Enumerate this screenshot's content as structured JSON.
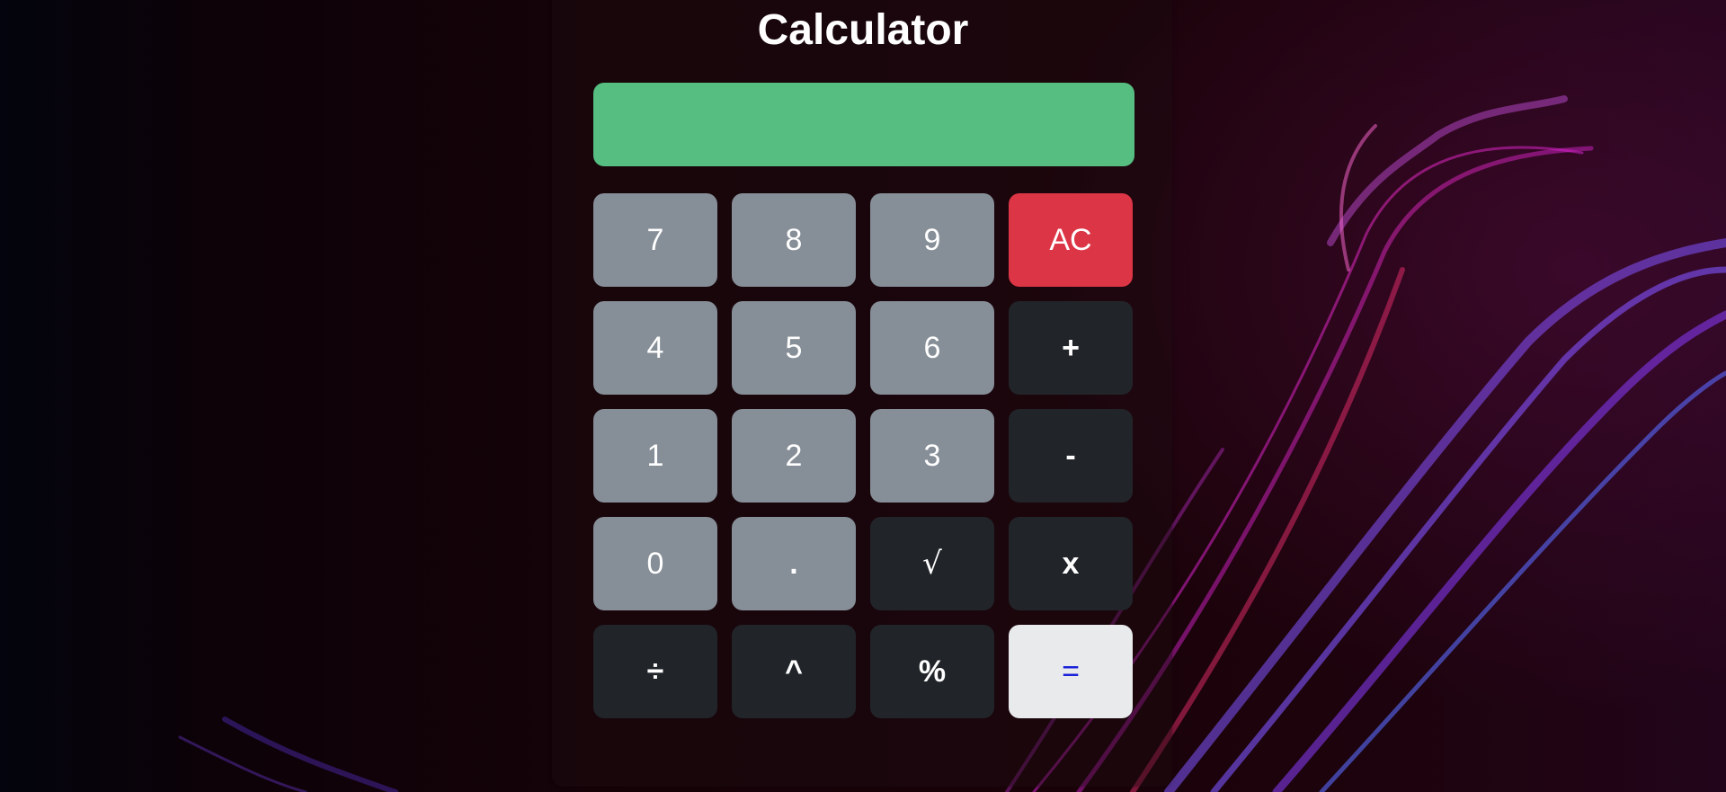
{
  "title": "Calculator",
  "display": {
    "value": ""
  },
  "colors": {
    "display_background": "#55be80",
    "digit_key": "#868e97",
    "operator_key": "#212529",
    "clear_key": "#dc3545",
    "equals_key": "#e8eaeb",
    "equals_text": "#1a23d8"
  },
  "keys": {
    "seven": "7",
    "eight": "8",
    "nine": "9",
    "clear": "AC",
    "four": "4",
    "five": "5",
    "six": "6",
    "plus": "+",
    "one": "1",
    "two": "2",
    "three": "3",
    "minus": "-",
    "zero": "0",
    "decimal": ".",
    "sqrt": "√",
    "multiply": "x",
    "divide": "÷",
    "power": "^",
    "percent": "%",
    "equals": "="
  }
}
